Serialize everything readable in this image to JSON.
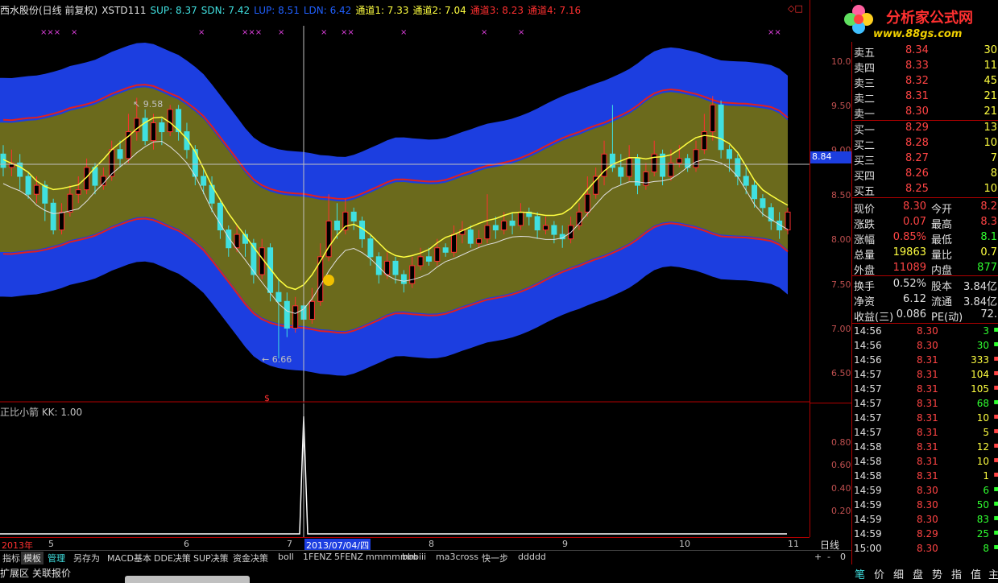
{
  "header": {
    "stock_name": "西水股份(日线 前复权)",
    "indicator": "XSTD111",
    "sup": "SUP: 8.37",
    "sdn": "SDN: 7.42",
    "lup": "LUP: 8.51",
    "ldn": "LDN: 6.42",
    "ch1": "通道1: 7.33",
    "ch2": "通道2: 7.04",
    "ch3": "通道3: 8.23",
    "ch4": "通道4: 7.16",
    "corner_icon": "◇□"
  },
  "logo": {
    "brand": "分析家公式网",
    "url": "www.88gs.com"
  },
  "main_axis": {
    "ticks": [
      "10.00",
      "9.50",
      "9.00",
      "8.50",
      "8.00",
      "7.50",
      "7.00",
      "6.50"
    ],
    "crosshair_value": "8.84"
  },
  "annotations": {
    "high": "9.58",
    "low": "6.66"
  },
  "sub_chart": {
    "title": "正比小箭  KK: 1.00",
    "ticks": [
      "0.80",
      "0.60",
      "0.40",
      "0.20"
    ]
  },
  "date_bar": {
    "labels": [
      "2013年",
      "5",
      "6",
      "7",
      "2013/07/04/四",
      "8",
      "9",
      "10",
      "11"
    ],
    "period": "日线"
  },
  "toolbar": {
    "items": [
      "指标",
      "模板",
      "管理",
      "另存为",
      "MACD基本",
      "DDE决策",
      "SUP决策",
      "资金决策",
      "boll",
      "1FENZ",
      "5FENZ",
      "mmmmmm",
      "bbbiii",
      "ma3cross",
      "快一步",
      "ddddd"
    ],
    "controls": [
      "+",
      "-",
      "0"
    ]
  },
  "statusbar": {
    "items": [
      "扩展区",
      "关联报价"
    ]
  },
  "order_book": {
    "asks": [
      {
        "label": "卖五",
        "price": "8.34",
        "vol": "30"
      },
      {
        "label": "卖四",
        "price": "8.33",
        "vol": "11"
      },
      {
        "label": "卖三",
        "price": "8.32",
        "vol": "45"
      },
      {
        "label": "卖二",
        "price": "8.31",
        "vol": "21"
      },
      {
        "label": "卖一",
        "price": "8.30",
        "vol": "21"
      }
    ],
    "bids": [
      {
        "label": "买一",
        "price": "8.29",
        "vol": "13"
      },
      {
        "label": "买二",
        "price": "8.28",
        "vol": "10"
      },
      {
        "label": "买三",
        "price": "8.27",
        "vol": "7"
      },
      {
        "label": "买四",
        "price": "8.26",
        "vol": "8"
      },
      {
        "label": "买五",
        "price": "8.25",
        "vol": "10"
      }
    ]
  },
  "quote": {
    "current_label": "现价",
    "current": "8.30",
    "open_label": "今开",
    "open": "8.2",
    "change_label": "涨跌",
    "change": "0.07",
    "high_label": "最高",
    "high": "8.3",
    "pct_label": "涨幅",
    "pct": "0.85%",
    "low_label": "最低",
    "low": "8.1",
    "vol_label": "总量",
    "vol": "19863",
    "ratio_label": "量比",
    "ratio": "0.7",
    "outer_label": "外盘",
    "outer": "11089",
    "inner_label": "内盘",
    "inner": "877",
    "turnover_label": "换手",
    "turnover": "0.52%",
    "share_label": "股本",
    "share": "3.84亿",
    "nav_label": "净资",
    "nav": "6.12",
    "float_label": "流通",
    "float": "3.84亿",
    "eps_label": "收益(三)",
    "eps": "0.086",
    "pe_label": "PE(动)",
    "pe": "72."
  },
  "ticks": [
    {
      "t": "14:56",
      "p": "8.30",
      "v": "3",
      "c": "S"
    },
    {
      "t": "14:56",
      "p": "8.30",
      "v": "30",
      "c": "S"
    },
    {
      "t": "14:56",
      "p": "8.31",
      "v": "333",
      "c": "B"
    },
    {
      "t": "14:57",
      "p": "8.31",
      "v": "104",
      "c": "B"
    },
    {
      "t": "14:57",
      "p": "8.31",
      "v": "105",
      "c": "B"
    },
    {
      "t": "14:57",
      "p": "8.31",
      "v": "68",
      "c": "S"
    },
    {
      "t": "14:57",
      "p": "8.31",
      "v": "10",
      "c": "B"
    },
    {
      "t": "14:57",
      "p": "8.31",
      "v": "5",
      "c": "B"
    },
    {
      "t": "14:58",
      "p": "8.31",
      "v": "12",
      "c": "B"
    },
    {
      "t": "14:58",
      "p": "8.31",
      "v": "10",
      "c": "B"
    },
    {
      "t": "14:58",
      "p": "8.31",
      "v": "1",
      "c": "B"
    },
    {
      "t": "14:59",
      "p": "8.30",
      "v": "6",
      "c": "S"
    },
    {
      "t": "14:59",
      "p": "8.30",
      "v": "50",
      "c": "S"
    },
    {
      "t": "14:59",
      "p": "8.30",
      "v": "83",
      "c": "S"
    },
    {
      "t": "14:59",
      "p": "8.29",
      "v": "25",
      "c": "S"
    },
    {
      "t": "15:00",
      "p": "8.30",
      "v": "8",
      "c": "S"
    }
  ],
  "bottom_tabs": [
    "笔",
    "价",
    "细",
    "盘",
    "势",
    "指",
    "值",
    "主"
  ],
  "colors": {
    "band_outer": "#1c3ee0",
    "band_inner": "#6b6a1c",
    "ma_red": "#e02020",
    "ma_yellow": "#ffff40",
    "up": "#ff3030",
    "down": "#40e0e0",
    "grid": "#b00000"
  },
  "candles": [
    [
      8.95,
      8.8,
      9.05,
      8.7
    ],
    [
      8.8,
      8.85,
      9.0,
      8.7
    ],
    [
      8.85,
      8.7,
      8.95,
      8.55
    ],
    [
      8.7,
      8.5,
      8.75,
      8.45
    ],
    [
      8.5,
      8.6,
      8.7,
      8.4
    ],
    [
      8.6,
      8.4,
      8.65,
      8.2
    ],
    [
      8.4,
      8.1,
      8.45,
      8.05
    ],
    [
      8.1,
      8.3,
      8.4,
      8.05
    ],
    [
      8.3,
      8.5,
      8.6,
      8.25
    ],
    [
      8.5,
      8.55,
      8.7,
      8.4
    ],
    [
      8.55,
      8.8,
      8.9,
      8.5
    ],
    [
      8.8,
      8.6,
      8.85,
      8.5
    ],
    [
      8.6,
      8.7,
      8.8,
      8.55
    ],
    [
      8.7,
      9.0,
      9.1,
      8.65
    ],
    [
      9.0,
      8.9,
      9.1,
      8.8
    ],
    [
      8.9,
      9.2,
      9.4,
      8.85
    ],
    [
      9.2,
      9.35,
      9.58,
      9.1
    ],
    [
      9.35,
      9.1,
      9.45,
      9.05
    ],
    [
      9.1,
      9.3,
      9.4,
      9.0
    ],
    [
      9.3,
      9.2,
      9.35,
      9.05
    ],
    [
      9.2,
      9.45,
      9.5,
      9.15
    ],
    [
      9.45,
      9.2,
      9.5,
      9.1
    ],
    [
      9.2,
      9.0,
      9.3,
      8.9
    ],
    [
      9.0,
      8.7,
      9.05,
      8.6
    ],
    [
      8.7,
      8.6,
      8.8,
      8.5
    ],
    [
      8.6,
      8.4,
      8.7,
      8.3
    ],
    [
      8.4,
      8.1,
      8.45,
      8.0
    ],
    [
      8.1,
      7.9,
      8.15,
      7.8
    ],
    [
      7.9,
      8.05,
      8.15,
      7.85
    ],
    [
      8.05,
      7.95,
      8.1,
      7.8
    ],
    [
      7.95,
      7.6,
      8.0,
      7.5
    ],
    [
      7.6,
      7.9,
      8.0,
      7.55
    ],
    [
      7.9,
      7.4,
      7.95,
      7.3
    ],
    [
      7.4,
      7.3,
      7.55,
      6.66
    ],
    [
      7.3,
      7.0,
      7.4,
      6.9
    ],
    [
      7.0,
      7.25,
      7.35,
      6.95
    ],
    [
      7.25,
      7.1,
      7.35,
      7.0
    ],
    [
      7.1,
      7.3,
      7.45,
      7.05
    ],
    [
      7.3,
      7.8,
      7.95,
      7.25
    ],
    [
      7.8,
      8.2,
      8.5,
      7.75
    ],
    [
      8.2,
      8.1,
      8.4,
      8.0
    ],
    [
      8.1,
      8.3,
      8.45,
      8.05
    ],
    [
      8.3,
      8.2,
      8.35,
      8.1
    ],
    [
      8.2,
      8.0,
      8.25,
      7.9
    ],
    [
      8.0,
      7.8,
      8.05,
      7.7
    ],
    [
      7.8,
      7.6,
      7.85,
      7.5
    ],
    [
      7.6,
      7.75,
      7.85,
      7.55
    ],
    [
      7.75,
      7.6,
      7.8,
      7.5
    ],
    [
      7.6,
      7.5,
      7.65,
      7.4
    ],
    [
      7.5,
      7.7,
      7.8,
      7.45
    ],
    [
      7.7,
      7.8,
      7.9,
      7.65
    ],
    [
      7.8,
      7.75,
      7.9,
      7.7
    ],
    [
      7.75,
      7.9,
      8.0,
      7.7
    ],
    [
      7.9,
      7.85,
      7.95,
      7.8
    ],
    [
      7.85,
      8.05,
      8.15,
      7.8
    ],
    [
      8.05,
      8.1,
      8.2,
      7.95
    ],
    [
      8.1,
      7.95,
      8.15,
      7.9
    ],
    [
      7.95,
      8.0,
      8.1,
      7.9
    ],
    [
      8.0,
      8.15,
      8.5,
      7.95
    ],
    [
      8.15,
      8.1,
      8.25,
      8.0
    ],
    [
      8.1,
      8.2,
      8.3,
      8.05
    ],
    [
      8.2,
      8.15,
      8.3,
      8.05
    ],
    [
      8.15,
      8.3,
      8.4,
      8.1
    ],
    [
      8.3,
      8.25,
      8.35,
      8.15
    ],
    [
      8.25,
      8.1,
      8.3,
      8.0
    ],
    [
      8.1,
      8.15,
      8.25,
      8.05
    ],
    [
      8.15,
      8.05,
      8.2,
      7.95
    ],
    [
      8.05,
      8.0,
      8.15,
      7.9
    ],
    [
      8.0,
      8.15,
      8.25,
      7.95
    ],
    [
      8.15,
      8.3,
      8.4,
      8.1
    ],
    [
      8.3,
      8.5,
      8.7,
      8.25
    ],
    [
      8.5,
      8.7,
      8.8,
      8.45
    ],
    [
      8.7,
      8.95,
      9.1,
      8.6
    ],
    [
      8.95,
      8.8,
      9.5,
      8.75
    ],
    [
      8.8,
      8.7,
      8.95,
      8.6
    ],
    [
      8.7,
      8.9,
      9.05,
      8.65
    ],
    [
      8.9,
      8.6,
      8.95,
      8.5
    ],
    [
      8.6,
      8.75,
      8.85,
      8.55
    ],
    [
      8.75,
      8.95,
      9.1,
      8.7
    ],
    [
      8.95,
      8.7,
      9.0,
      8.6
    ],
    [
      8.7,
      8.85,
      9.0,
      8.65
    ],
    [
      8.85,
      8.9,
      9.05,
      8.8
    ],
    [
      8.9,
      8.8,
      8.95,
      8.75
    ],
    [
      8.8,
      9.0,
      9.1,
      8.75
    ],
    [
      9.0,
      9.2,
      9.4,
      8.95
    ],
    [
      9.2,
      9.5,
      9.6,
      9.1
    ],
    [
      9.5,
      9.0,
      9.55,
      8.9
    ],
    [
      9.0,
      8.9,
      9.05,
      8.75
    ],
    [
      8.9,
      8.7,
      8.95,
      8.6
    ],
    [
      8.7,
      8.6,
      8.8,
      8.5
    ],
    [
      8.6,
      8.45,
      8.65,
      8.35
    ],
    [
      8.45,
      8.35,
      8.5,
      8.25
    ],
    [
      8.35,
      8.2,
      8.4,
      8.1
    ],
    [
      8.2,
      8.1,
      8.3,
      8.0
    ],
    [
      8.1,
      8.3,
      8.35,
      8.05
    ]
  ]
}
